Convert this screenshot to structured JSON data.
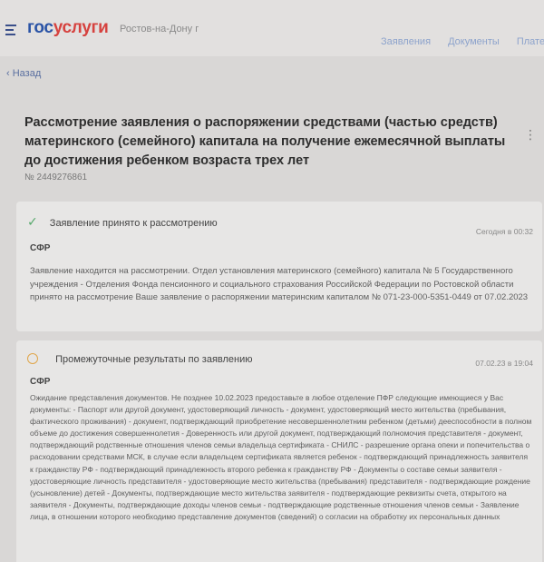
{
  "header": {
    "logo_part1": "гос",
    "logo_part2": "услуги",
    "city": "Ростов-на-Дону г",
    "nav": [
      "Заявления",
      "Документы",
      "Платеж"
    ]
  },
  "back_label": "Назад",
  "title": "Рассмотрение заявления о распоряжении средствами (частью средств) материнского (семейного) капитала на получение ежемесячной выплаты до достижения ребенком возраста трех лет",
  "application_number": "№ 2449276861",
  "events": [
    {
      "status": "Заявление принято к рассмотрению",
      "date": "Сегодня в 00:32",
      "sender": "СФР",
      "text": "Заявление находится на рассмотрении. Отдел установления материнского (семейного) капитала № 5 Государственного учреждения - Отделения Фонда пенсионного и социального страхования Российской Федерации по Ростовской области принято на рассмотрение Ваше заявление о распоряжении материнским капиталом № 071-23-000-5351-0449 от 07.02.2023"
    },
    {
      "status": "Промежуточные результаты по заявлению",
      "date": "07.02.23 в 19:04",
      "sender": "СФР",
      "text": "Ожидание представления документов. Не позднее 10.02.2023 предоставьте в любое отделение ПФР следующие имеющиеся у Вас документы: - Паспорт или другой документ, удостоверяющий личность - документ, удостоверяющий место жительства (пребывания, фактического проживания) - документ, подтверждающий приобретение несовершеннолетним ребенком (детьми) дееспособности в полном объеме до достижения совершеннолетия - Доверенность или другой документ, подтверждающий полномочия представителя - документ, подтверждающий родственные отношения членов семьи владельца сертификата - СНИЛС - разрешение органа опеки и попечительства о расходовании средствами МСК, в случае если владельцем сертификата является ребенок - подтверждающий принадлежность заявителя к гражданству РФ - подтверждающий принадлежность второго ребенка к гражданству РФ - Документы о составе семьи заявителя - удостоверяющие личность представителя - удостоверяющие место жительства (пребывания) представителя - подтверждающие рождение (усыновление) детей - Документы, подтверждающие место жительства заявителя - подтверждающие реквизиты счета, открытого на заявителя - Документы, подтверждающие доходы членов семьи - подтверждающие родственные отношения членов семьи - Заявление лица, в отношении которого необходимо представление документов (сведений) о согласии на обработку их персональных данных"
    }
  ]
}
